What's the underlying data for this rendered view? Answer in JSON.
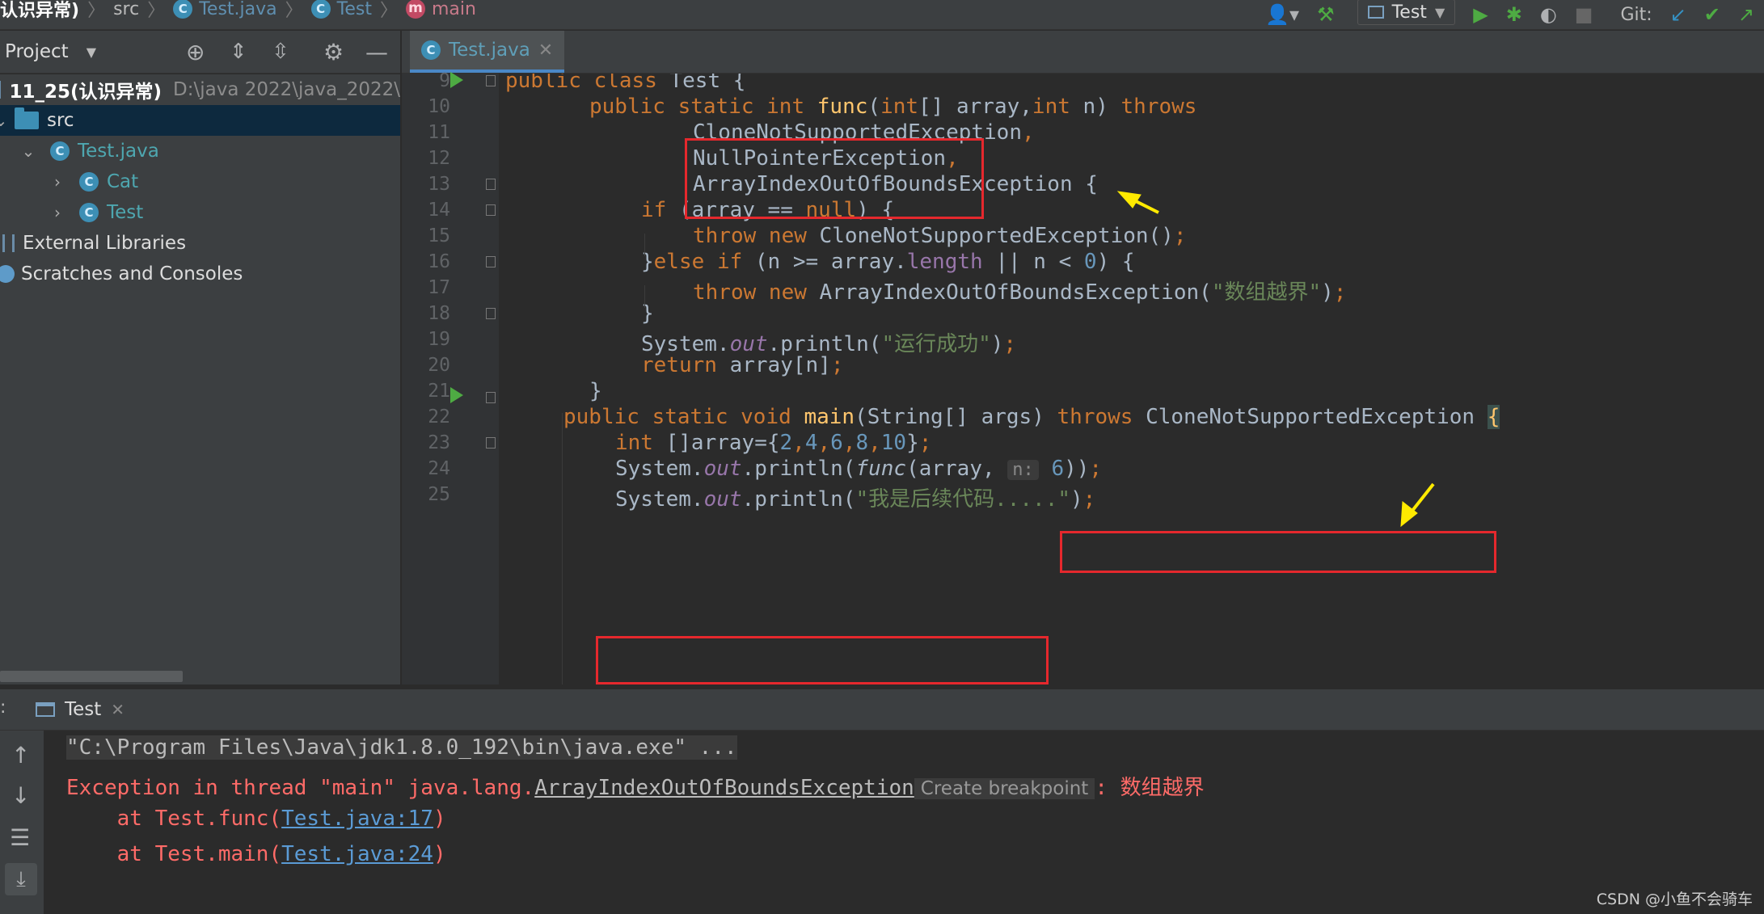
{
  "breadcrumb": {
    "project": "认识异常)",
    "src": "src",
    "file": "Test.java",
    "class": "Test",
    "method": "main"
  },
  "toolbar": {
    "run_config": "Test",
    "git_label": "Git:"
  },
  "project_panel": {
    "title": "Project",
    "tree": [
      {
        "label": "11_25(认识异常)",
        "path": "D:\\java 2022\\java_2022\\"
      },
      {
        "label": "src"
      },
      {
        "label": "Test.java"
      },
      {
        "label": "Cat"
      },
      {
        "label": "Test"
      },
      {
        "label": "External Libraries"
      },
      {
        "label": "Scratches and Consoles"
      }
    ]
  },
  "editor": {
    "tab_label": "Test.java",
    "line_numbers": [
      "9",
      "10",
      "11",
      "12",
      "13",
      "14",
      "15",
      "16",
      "17",
      "18",
      "19",
      "20",
      "21",
      "22",
      "23",
      "24",
      "25"
    ],
    "code": {
      "l9": [
        "public ",
        "class ",
        "Test {"
      ],
      "l10": [
        "public ",
        "static ",
        "int ",
        "func",
        "(",
        "int",
        "[] array,",
        "int ",
        "n) ",
        "throws"
      ],
      "l11": [
        "CloneNotSupportedException",
        ","
      ],
      "l12": [
        "NullPointerException",
        ","
      ],
      "l13": [
        "ArrayIndexOutOfBoundsException",
        " {"
      ],
      "l14": [
        "if ",
        "(array == ",
        "null",
        ") {"
      ],
      "l15": [
        "throw ",
        "new ",
        "CloneNotSupportedException()",
        ";"
      ],
      "l16": [
        "}",
        "else ",
        "if ",
        "(n >= array.",
        "length",
        " || n < ",
        "0",
        ") {"
      ],
      "l17": [
        "throw ",
        "new ",
        "ArrayIndexOutOfBoundsException(",
        "\"数组越界\"",
        ")",
        ";"
      ],
      "l18": [
        "}"
      ],
      "l19": [
        "System.",
        "out",
        ".println(",
        "\"运行成功\"",
        ")",
        ";"
      ],
      "l20": [
        "return ",
        "array[n]",
        ";"
      ],
      "l21": [
        "}"
      ],
      "l22": [
        "public ",
        "static ",
        "void ",
        "main",
        "(String[] args) ",
        "throws ",
        "CloneNotSupportedException ",
        "{"
      ],
      "l23": [
        "int ",
        "[]array={",
        "2",
        ",",
        "4",
        ",",
        "6",
        ",",
        "8",
        ",",
        "10",
        "}",
        ";"
      ],
      "l24": [
        "System.",
        "out",
        ".println(",
        "func",
        "(array, ",
        "n:",
        " ",
        "6",
        "))",
        ";"
      ],
      "l25": [
        "System.",
        "out",
        ".println(",
        "\"我是后续代码.....\"",
        ")",
        ";"
      ]
    }
  },
  "run_panel": {
    "tab_label": "Test",
    "lines": {
      "cmd": "\"C:\\Program Files\\Java\\jdk1.8.0_192\\bin\\java.exe\" ...",
      "exc_prefix": "Exception in thread \"main\" java.lang.",
      "exc_class": "ArrayIndexOutOfBoundsException",
      "create_bp": "Create breakpoint",
      "exc_msg": ": 数组越界",
      "at1_prefix": "    at Test.func(",
      "at1_link": "Test.java:17",
      "at2_prefix": "    at Test.main(",
      "at2_link": "Test.java:24",
      "close_paren": ")"
    }
  },
  "watermark": "CSDN @小鱼不会骑车"
}
